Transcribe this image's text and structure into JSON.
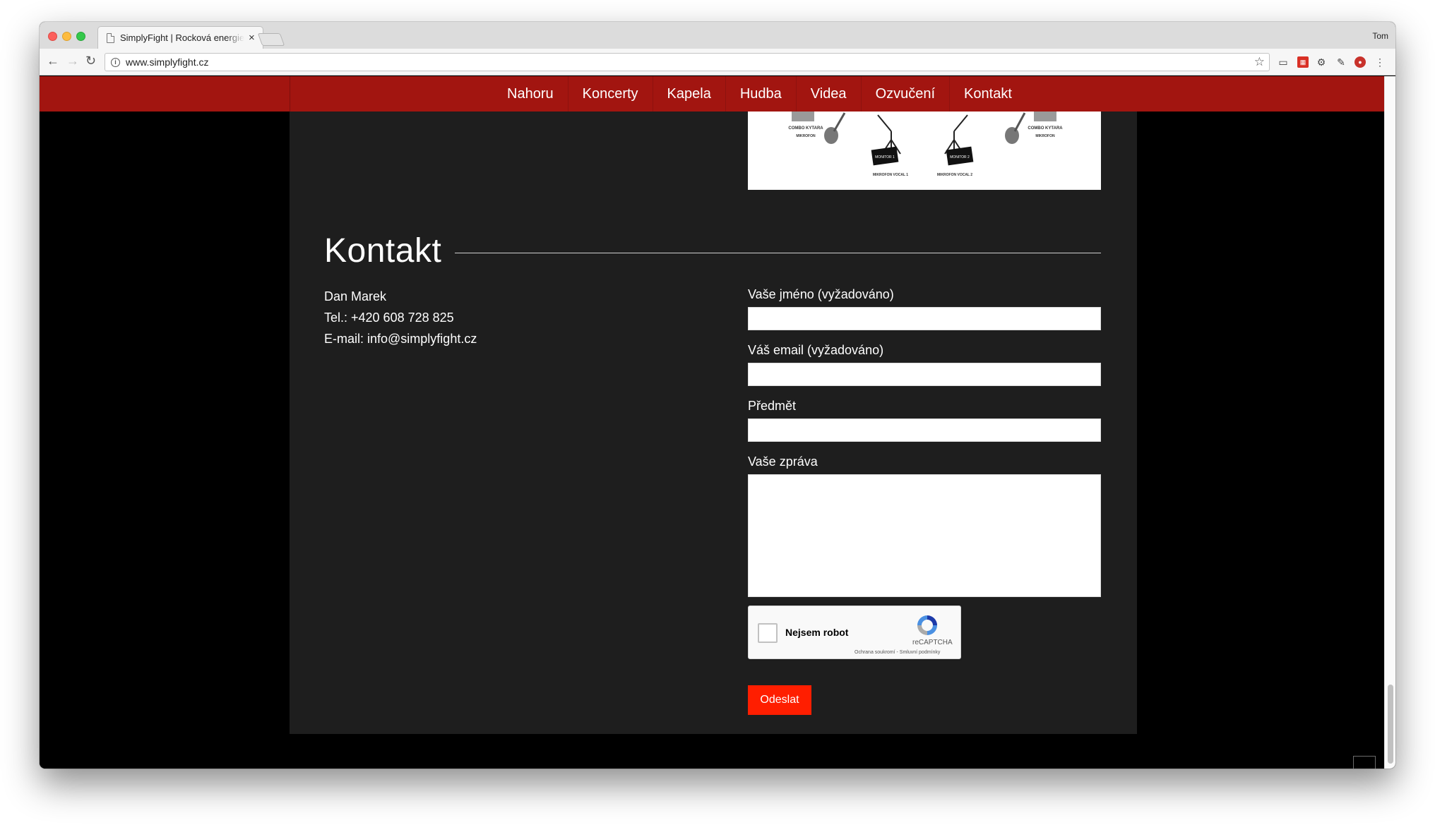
{
  "browser": {
    "tab_title": "SimplyFight | Rocková energie",
    "tab_close": "×",
    "profile_name": "Tom",
    "url": "www.simplyfight.cz"
  },
  "nav": {
    "items": [
      "Nahoru",
      "Koncerty",
      "Kapela",
      "Hudba",
      "Videa",
      "Ozvučení",
      "Kontakt"
    ]
  },
  "stage_plot": {
    "labels": [
      "COMBO KYTARA",
      "MIKROFON",
      "MONITOR 1",
      "MIKROFON VOCAL 1",
      "MONITOR 2",
      "MIKROFON VOCAL 2",
      "COMBO KYTARA",
      "MIKROFON"
    ]
  },
  "contact": {
    "heading": "Kontakt",
    "name": "Dan Marek",
    "phone": "Tel.: +420 608 728 825",
    "email": "E-mail: info@simplyfight.cz"
  },
  "form": {
    "name_label": "Vaše jméno (vyžadováno)",
    "email_label": "Váš email (vyžadováno)",
    "subject_label": "Předmět",
    "message_label": "Vaše zpráva",
    "captcha_label": "Nejsem robot",
    "captcha_brand": "reCAPTCHA",
    "captcha_links": "Ochrana soukromí - Smluvní podmínky",
    "submit_label": "Odeslat"
  },
  "colors": {
    "navbar": "#a21510",
    "content_bg": "#1e1e1e",
    "submit": "#ff1e00"
  }
}
